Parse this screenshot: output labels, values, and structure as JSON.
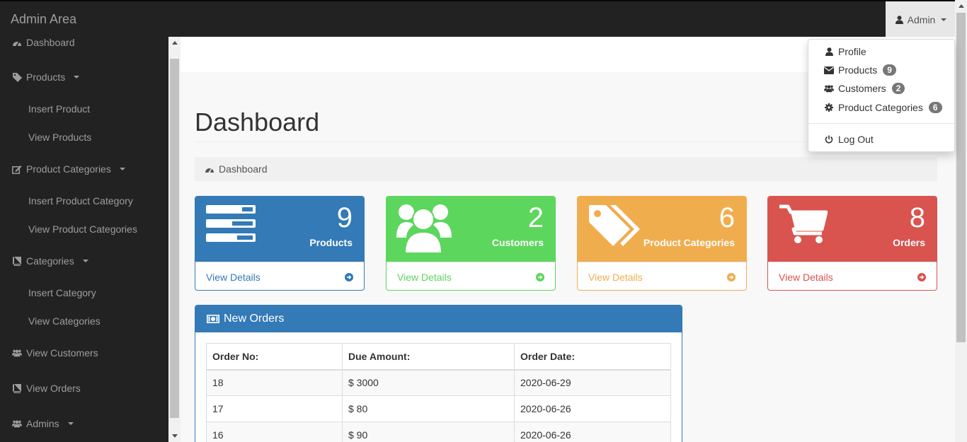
{
  "brand": "Admin Area",
  "user_menu": {
    "label": "Admin"
  },
  "sidebar": {
    "items": [
      {
        "label": "Dashboard",
        "icon": "dashboard-icon"
      },
      {
        "label": "Products",
        "icon": "tag-icon",
        "children": [
          "Insert Product",
          "View Products"
        ]
      },
      {
        "label": "Product Categories",
        "icon": "edit-icon",
        "children": [
          "Insert Product Category",
          "View Product Categories"
        ]
      },
      {
        "label": "Categories",
        "icon": "book-icon",
        "children": [
          "Insert Category",
          "View Categories"
        ]
      },
      {
        "label": "View Customers",
        "icon": "users-icon"
      },
      {
        "label": "View Orders",
        "icon": "book-icon"
      },
      {
        "label": "Admins",
        "icon": "users-icon"
      }
    ]
  },
  "page": {
    "title": "Dashboard",
    "breadcrumb": "Dashboard"
  },
  "cards": [
    {
      "count": "9",
      "label": "Products",
      "link": "View Details",
      "color": "#337ab7"
    },
    {
      "count": "2",
      "label": "Customers",
      "link": "View Details",
      "color": "#5cd65c"
    },
    {
      "count": "6",
      "label": "Product Categories",
      "link": "View Details",
      "color": "#f0ad4e"
    },
    {
      "count": "8",
      "label": "Orders",
      "link": "View Details",
      "color": "#d9534f"
    }
  ],
  "orders": {
    "title": "New Orders",
    "headers": [
      "Order No:",
      "Due Amount:",
      "Order Date:"
    ],
    "rows": [
      [
        "18",
        "$ 3000",
        "2020-06-29"
      ],
      [
        "17",
        "$ 80",
        "2020-06-26"
      ],
      [
        "16",
        "$ 90",
        "2020-06-26"
      ]
    ]
  },
  "dropdown": {
    "items": [
      {
        "label": "Profile",
        "icon": "user-icon",
        "badge": ""
      },
      {
        "label": "Products",
        "icon": "envelope-icon",
        "badge": "9"
      },
      {
        "label": "Customers",
        "icon": "users-icon",
        "badge": "2"
      },
      {
        "label": "Product Categories",
        "icon": "gear-icon",
        "badge": "6"
      }
    ],
    "logout": "Log Out"
  }
}
